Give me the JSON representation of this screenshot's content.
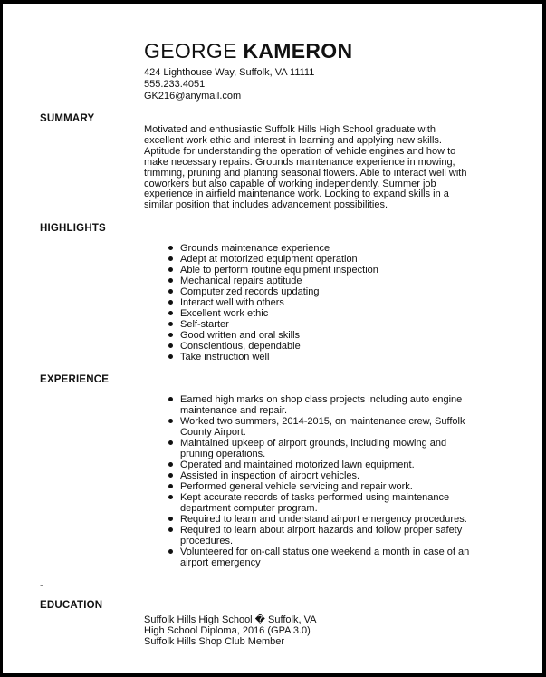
{
  "header": {
    "first_name": "GEORGE",
    "last_name": "KAMERON",
    "address": "424 Lighthouse Way, Suffolk, VA 11111",
    "phone": "555.233.4051",
    "email": "GK216@anymail.com"
  },
  "summary": {
    "heading": "SUMMARY",
    "lines": [
      "Motivated and enthusiastic Suffolk Hills High School graduate with",
      "excellent work ethic and interest in learning and applying new skills.",
      "Aptitude for understanding the operation of vehicle engines and how to",
      "make necessary repairs. Grounds maintenance experience in mowing,",
      "trimming, pruning and planting seasonal flowers. Able to interact well with",
      "coworkers but also capable of working independently. Summer job",
      "experience in airfield maintenance work. Looking to expand skills in a",
      "similar position that includes advancement possibilities."
    ]
  },
  "highlights": {
    "heading": "HIGHLIGHTS",
    "items": [
      "Grounds maintenance experience",
      "Adept at motorized equipment operation",
      "Able to perform routine equipment inspection",
      "Mechanical repairs aptitude",
      "Computerized records updating",
      "Interact well with others",
      "Excellent work ethic",
      "Self-starter",
      "Good written and oral skills",
      "Conscientious, dependable",
      "Take instruction well"
    ]
  },
  "experience": {
    "heading": "EXPERIENCE",
    "items": [
      [
        "Earned high marks on shop class projects including auto engine",
        "maintenance and repair."
      ],
      [
        "Worked two summers, 2014-2015, on maintenance crew, Suffolk",
        "County Airport."
      ],
      [
        "Maintained upkeep of airport grounds, including mowing and",
        "pruning operations."
      ],
      [
        "Operated and maintained motorized lawn equipment."
      ],
      [
        "Assisted in inspection of airport vehicles."
      ],
      [
        "Performed general vehicle servicing and repair work."
      ],
      [
        "Kept accurate records of tasks performed using maintenance",
        "department computer program."
      ],
      [
        "Required to learn and understand airport emergency procedures."
      ],
      [
        "Required to learn about airport hazards and follow proper safety",
        "procedures."
      ],
      [
        "Volunteered for on-call status one weekend a month in case of an",
        "airport emergency"
      ]
    ]
  },
  "separator": "-",
  "education": {
    "heading": "EDUCATION",
    "lines": [
      "Suffolk Hills High School � Suffolk, VA",
      "High School Diploma, 2016 (GPA 3.0)",
      "Suffolk Hills Shop Club Member"
    ]
  }
}
